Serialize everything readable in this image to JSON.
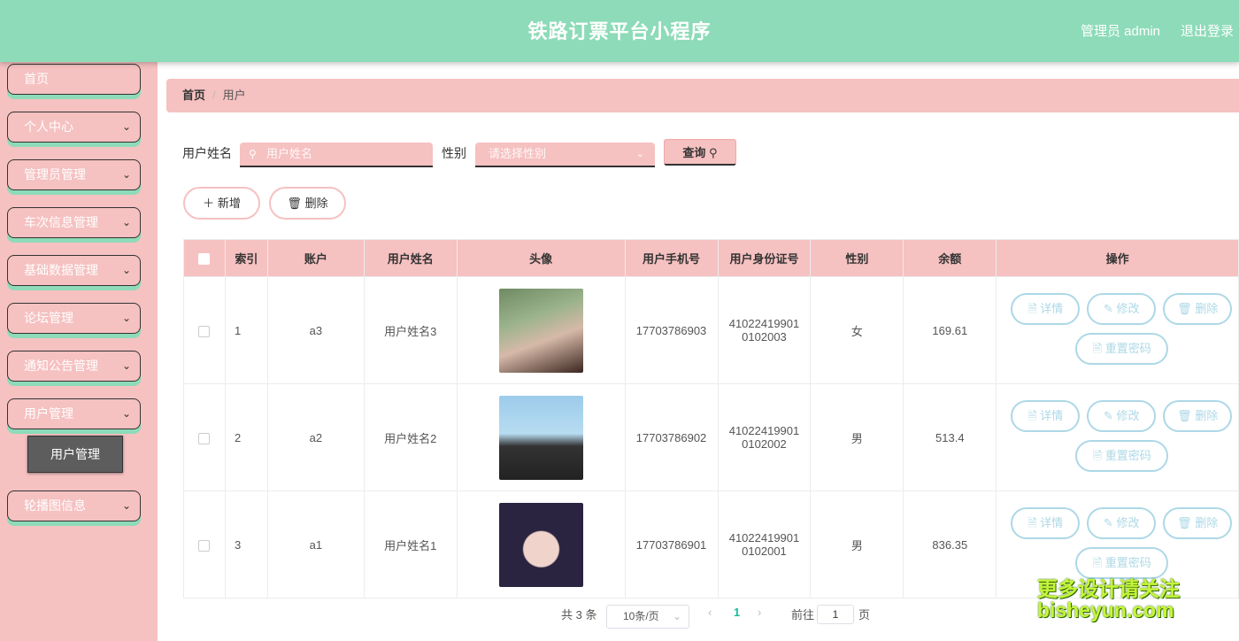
{
  "header": {
    "title": "铁路订票平台小程序",
    "admin": "管理员 admin",
    "logout": "退出登录"
  },
  "sidebar": {
    "items": [
      {
        "label": "首页",
        "has_arrow": false
      },
      {
        "label": "个人中心",
        "has_arrow": true
      },
      {
        "label": "管理员管理",
        "has_arrow": true
      },
      {
        "label": "车次信息管理",
        "has_arrow": true
      },
      {
        "label": "基础数据管理",
        "has_arrow": true
      },
      {
        "label": "论坛管理",
        "has_arrow": true
      },
      {
        "label": "通知公告管理",
        "has_arrow": true
      },
      {
        "label": "用户管理",
        "has_arrow": true
      },
      {
        "label": "轮播图信息",
        "has_arrow": true
      }
    ],
    "sub_item": "用户管理"
  },
  "breadcrumb": {
    "home": "首页",
    "sep": "/",
    "current": "用户"
  },
  "search": {
    "name_label": "用户姓名",
    "name_placeholder": "用户姓名",
    "gender_label": "性别",
    "gender_placeholder": "请选择性别",
    "query_label": "查询"
  },
  "actions": {
    "add": "新增",
    "delete": "删除"
  },
  "table": {
    "headers": [
      "索引",
      "账户",
      "用户姓名",
      "头像",
      "用户手机号",
      "用户身份证号",
      "性别",
      "余额",
      "操作"
    ],
    "rows": [
      {
        "index": "1",
        "account": "a3",
        "name": "用户姓名3",
        "phone": "17703786903",
        "id_line1": "41022419901",
        "id_line2": "0102003",
        "gender": "女",
        "balance": "169.61"
      },
      {
        "index": "2",
        "account": "a2",
        "name": "用户姓名2",
        "phone": "17703786902",
        "id_line1": "41022419901",
        "id_line2": "0102002",
        "gender": "男",
        "balance": "513.4"
      },
      {
        "index": "3",
        "account": "a1",
        "name": "用户姓名1",
        "phone": "17703786901",
        "id_line1": "41022419901",
        "id_line2": "0102001",
        "gender": "男",
        "balance": "836.35"
      }
    ],
    "row_ops": {
      "detail": "详情",
      "edit": "修改",
      "delete": "删除",
      "reset": "重置密码"
    }
  },
  "pagination": {
    "total": "共 3 条",
    "page_size": "10条/页",
    "current_page": "1",
    "goto": "前往",
    "goto_value": "1",
    "page_unit": "页"
  },
  "watermark": {
    "line1": "更多设计请关注",
    "line2": "bisheyun.com"
  },
  "colors": {
    "header": "#8ddbb8",
    "sidebar": "#f6c1c1",
    "op_border": "#add8e6",
    "active_page": "#1abc9c"
  }
}
